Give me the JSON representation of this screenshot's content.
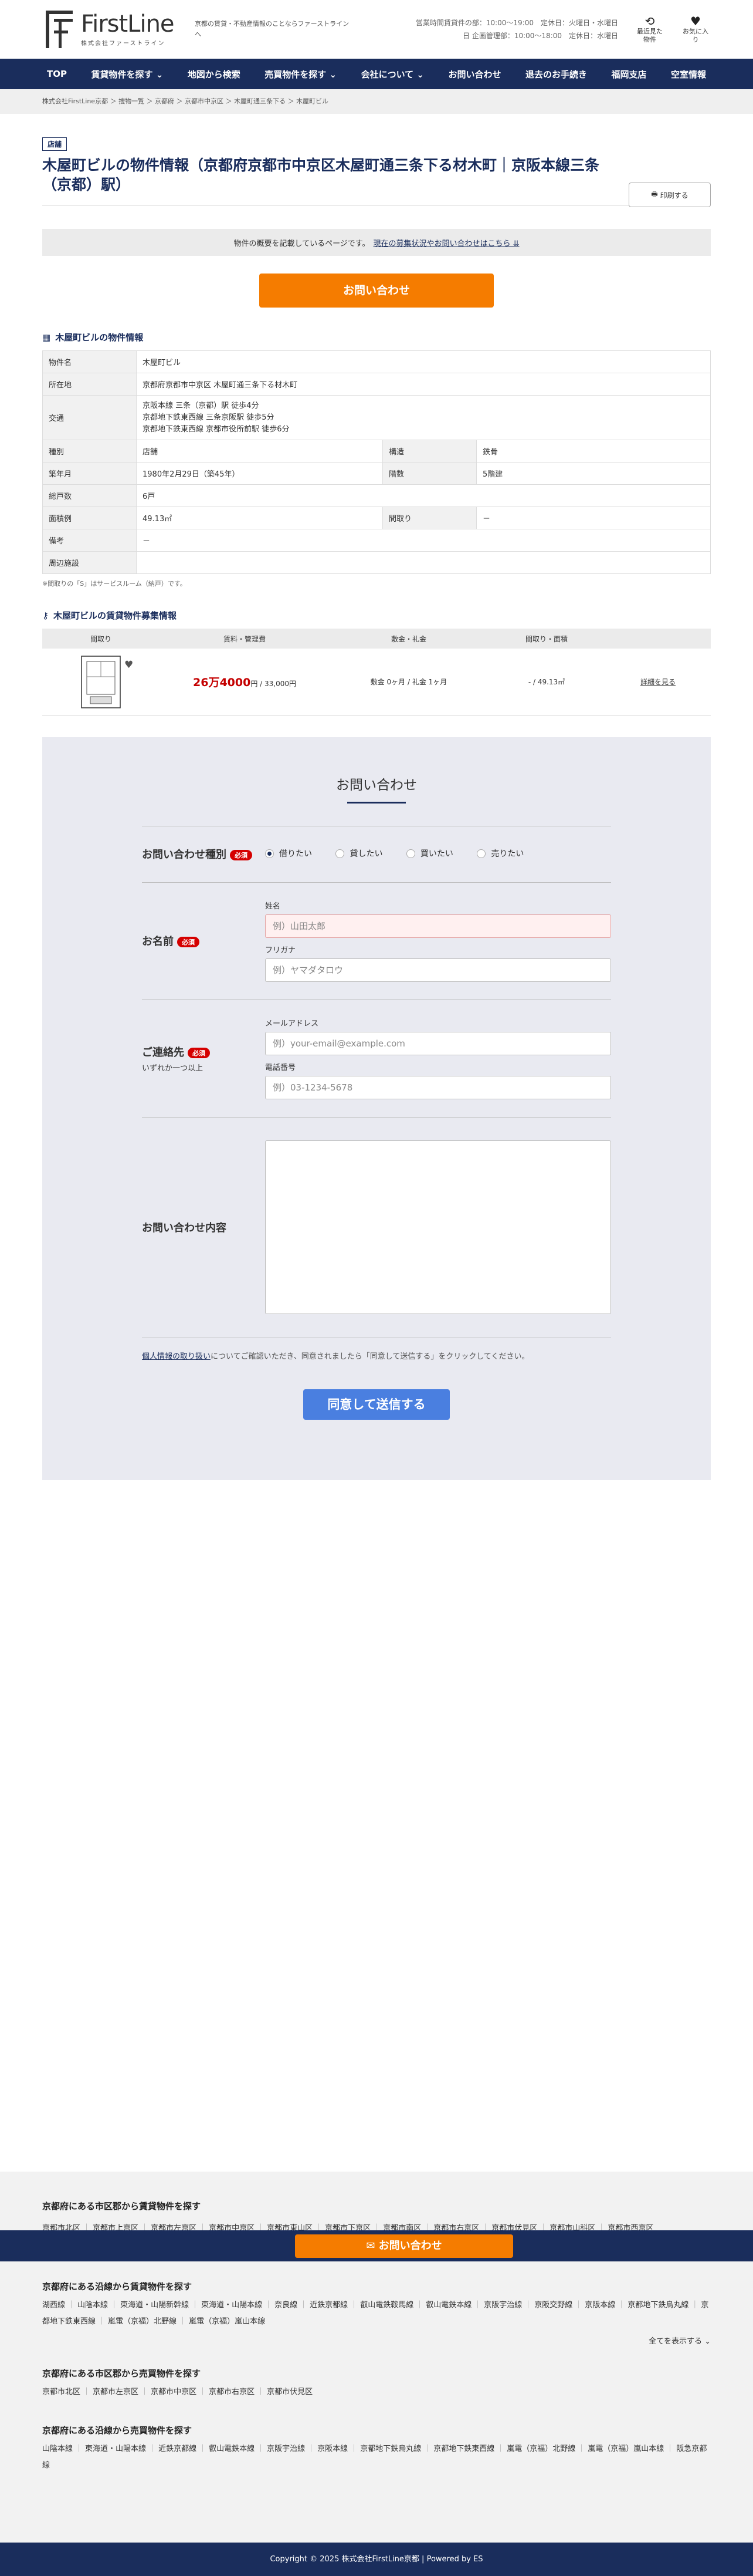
{
  "header": {
    "logo_name": "FirstLine",
    "logo_sub": "株式会社ファーストライン",
    "tagline": "京都の賃貸・不動産情報のことならファーストラインへ",
    "hours_line1": "営業時間賃貸件の部：10:00〜19:00　定休日：火曜日・水曜日",
    "hours_line2": "日 企画管理部：10:00〜18:00　定休日：水曜日",
    "icon_history": "最近見た物件",
    "icon_favorite": "お気に入り"
  },
  "nav": [
    "TOP",
    "賃貸物件を探す ⌄",
    "地図から検索",
    "売買物件を探す ⌄",
    "会社について ⌄",
    "お問い合わせ",
    "退去のお手続き",
    "福岡支店",
    "空室情報"
  ],
  "breadcrumb": "株式会社FirstLine京都 ＞ 捜物一覧 ＞ 京都府 ＞ 京都市中京区 ＞ 木屋町通三条下る ＞ 木屋町ビル",
  "property": {
    "badge": "店舗",
    "title": "木屋町ビルの物件情報（京都府京都市中京区木屋町通三条下る材木町｜京阪本線三条（京都）駅）",
    "print": "印刷する",
    "summary_text": "物件の概要を記載しているページです。",
    "summary_link": "現在の募集状況やお問い合わせはこちら ⇊",
    "cta": "お問い合わせ",
    "section_info": "木屋町ビルの物件情報",
    "rows": {
      "name_l": "物件名",
      "name_v": "木屋町ビル",
      "addr_l": "所在地",
      "addr_v": "京都府京都市中京区 木屋町通三条下る材木町",
      "traffic_l": "交通",
      "traffic_1": "京阪本線 三条（京都）駅 徒歩4分",
      "traffic_2": "京都地下鉄東西線 三条京阪駅 徒歩5分",
      "traffic_3": "京都地下鉄東西線 京都市役所前駅 徒歩6分",
      "type_l": "種別",
      "type_v": "店舗",
      "struct_l": "構造",
      "struct_v": "鉄骨",
      "built_l": "築年月",
      "built_v": "1980年2月29日（築45年）",
      "floors_l": "階数",
      "floors_v": "5階建",
      "units_l": "総戸数",
      "units_v": "6戸",
      "area_l": "面積例",
      "area_v": "49.13㎡",
      "layout_l": "間取り",
      "layout_v": "－",
      "remarks_l": "備考",
      "remarks_v": "－",
      "nearby_l": "周辺施設",
      "nearby_v": ""
    },
    "note": "※間取りの「S」はサービスルーム（納戸）です。",
    "section_list": "木屋町ビルの賃貸物件募集情報",
    "list_headers": [
      "間取り",
      "賃料・管理費",
      "敷金・礼金",
      "間取り・面積",
      ""
    ],
    "listing": {
      "rent": "26万4000",
      "rent_suffix": "円 / 33,000円",
      "deposit": "敷金 0ヶ月 / 礼金 1ヶ月",
      "layout": "- / 49.13㎡",
      "detail": "詳細を見る"
    }
  },
  "form": {
    "title": "お問い合わせ",
    "type_label": "お問い合わせ種別",
    "required": "必須",
    "types": [
      "借りたい",
      "貸したい",
      "買いたい",
      "売りたい"
    ],
    "name_label": "お名前",
    "name_sub": "姓名",
    "name_ph": "例）山田太郎",
    "kana_sub": "フリガナ",
    "kana_ph": "例）ヤマダタロウ",
    "contact_label": "ご連絡先",
    "contact_note": "いずれか一つ以上",
    "email_sub": "メールアドレス",
    "email_ph": "例）your-email@example.com",
    "tel_sub": "電話番号",
    "tel_ph": "例）03-1234-5678",
    "msg_label": "お問い合わせ内容",
    "privacy_link": "個人情報の取り扱い",
    "privacy_text": "についてご確認いただき、同意されましたら「同意して送信する」をクリックしてください。",
    "submit": "同意して送信する"
  },
  "footer": {
    "sec1": "京都府にある市区郡から賃貸物件を探す",
    "sec1_items": [
      "京都市北区",
      "京都市上京区",
      "京都市左京区",
      "京都市中京区",
      "京都市東山区",
      "京都市下京区",
      "京都市南区",
      "京都市右京区",
      "京都市伏見区",
      "京都市山科区",
      "京都市西京区"
    ],
    "sticky_cta": "お問い合わせ",
    "sec2": "京都府にある沿線から賃貸物件を探す",
    "sec2_items": [
      "湖西線",
      "山陰本線",
      "東海道・山陽新幹線",
      "東海道・山陽本線",
      "奈良線",
      "近鉄京都線",
      "叡山電鉄鞍馬線",
      "叡山電鉄本線",
      "京阪宇治線",
      "京阪交野線",
      "京阪本線",
      "京都地下鉄烏丸線",
      "京都地下鉄東西線",
      "嵐電（京福）北野線",
      "嵐電（京福）嵐山本線"
    ],
    "show_all": "全てを表示する ⌄",
    "sec3": "京都府にある市区郡から売買物件を探す",
    "sec3_items": [
      "京都市北区",
      "京都市左京区",
      "京都市中京区",
      "京都市右京区",
      "京都市伏見区"
    ],
    "sec4": "京都府にある沿線から売買物件を探す",
    "sec4_items": [
      "山陰本線",
      "東海道・山陽本線",
      "近鉄京都線",
      "叡山電鉄本線",
      "京阪宇治線",
      "京阪本線",
      "京都地下鉄烏丸線",
      "京都地下鉄東西線",
      "嵐電（京福）北野線",
      "嵐電（京福）嵐山本線",
      "阪急京都線"
    ],
    "copyright": "Copyright © 2025 株式会社FirstLine京都 | Powered by ES"
  }
}
